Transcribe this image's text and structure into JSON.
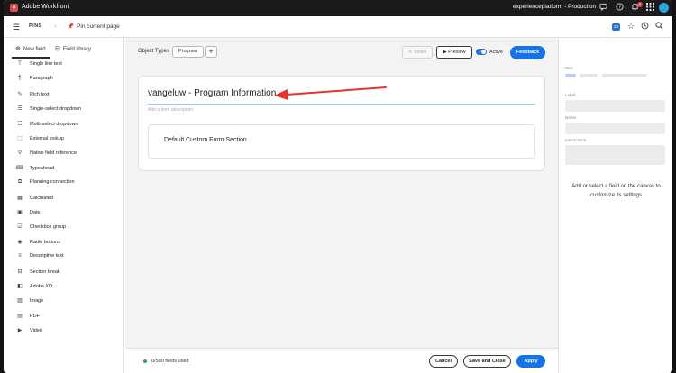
{
  "topbar": {
    "app_name": "Adobe Workfront",
    "logo_glyph": "a",
    "instance": "experienceplatform - Production",
    "notification_count": "8",
    "icons": [
      "chat-icon",
      "help-icon",
      "bell-icon",
      "apps-grid-icon",
      "user-avatar"
    ]
  },
  "secondbar": {
    "pins_label": "PINS",
    "pin_current_label": "Pin current page",
    "badge_count": "23",
    "icons": [
      "star-icon",
      "history-icon",
      "search-icon"
    ]
  },
  "sidebar": {
    "tabs": [
      {
        "label": "New field",
        "icon": "plus-circle-icon",
        "active": true
      },
      {
        "label": "Field library",
        "icon": "library-icon",
        "active": false
      }
    ],
    "items": [
      {
        "label": "Single line text",
        "glyph": "T"
      },
      {
        "label": "Paragraph",
        "glyph": "¶"
      },
      {
        "label": "Rich text",
        "glyph": "✎"
      },
      {
        "label": "Single-select dropdown",
        "glyph": "☰"
      },
      {
        "label": "Multi-select dropdown",
        "glyph": "☷"
      },
      {
        "label": "External lookup",
        "glyph": "⬚"
      },
      {
        "label": "Native field reference",
        "glyph": "⚲"
      },
      {
        "label": "Typeahead",
        "glyph": "⌨"
      },
      {
        "label": "Planning connection",
        "glyph": "⧉"
      },
      {
        "label": "Calculated",
        "glyph": "▦"
      },
      {
        "label": "Date",
        "glyph": "▣"
      },
      {
        "label": "Checkbox group",
        "glyph": "☑"
      },
      {
        "label": "Radio buttons",
        "glyph": "◉"
      },
      {
        "label": "Descriptive text",
        "glyph": "≡"
      },
      {
        "label": "Section break",
        "glyph": "⊟"
      },
      {
        "label": "Adobe XD",
        "glyph": "◧"
      },
      {
        "label": "Image",
        "glyph": "▨"
      },
      {
        "label": "PDF",
        "glyph": "▤"
      },
      {
        "label": "Video",
        "glyph": "▶"
      }
    ]
  },
  "toolbar": {
    "object_types_label": "Object Types",
    "object_type_pill": "Program",
    "add_label": "+",
    "share_label": "Share",
    "preview_label": "Preview",
    "active_label": "Active",
    "active_on": true,
    "feedback_label": "Feedback"
  },
  "form": {
    "title": "vangeluw - Program Information",
    "description_placeholder": "Add a form description",
    "section_title": "Default Custom Form Section"
  },
  "footer": {
    "fields_used": "0/500 fields used",
    "cancel_label": "Cancel",
    "save_close_label": "Save and Close",
    "apply_label": "Apply"
  },
  "right_panel": {
    "size_label": "Size",
    "label_label": "Label",
    "name_label": "Name",
    "instructions_label": "Instructions",
    "empty_message": "Add or select a field on the canvas to customize its settings"
  },
  "colors": {
    "accent": "#1473e6",
    "annotation_arrow": "#e8322b",
    "topbar_bg": "#1b1b1b"
  }
}
